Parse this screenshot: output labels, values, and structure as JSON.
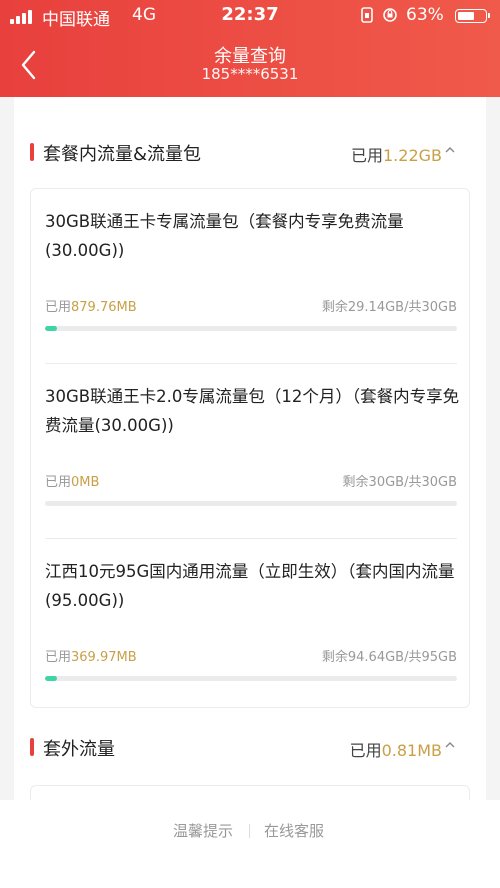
{
  "status_bar": {
    "carrier": "中国联通",
    "network": "4G",
    "time": "22:37",
    "battery_percent": "63%",
    "battery_level": 0.63
  },
  "nav": {
    "title": "余量查询",
    "phone": "185****6531"
  },
  "sections": [
    {
      "name": "套餐内流量&流量包",
      "used_prefix": "已用",
      "used_value": "1.22GB",
      "items": [
        {
          "name": "30GB联通王卡专属流量包（套餐内专享免费流量(30.00G))",
          "used_prefix": "已用",
          "used_value": "879.76MB",
          "remaining": "剩余29.14GB/共30GB",
          "progress": 0.029
        },
        {
          "name": "30GB联通王卡2.0专属流量包（12个月）（套餐内专享免费流量(30.00G))",
          "used_prefix": "已用",
          "used_value": "0MB",
          "remaining": "剩余30GB/共30GB",
          "progress": 0
        },
        {
          "name": "江西10元95G国内通用流量（立即生效）（套内国内流量(95.00G))",
          "used_prefix": "已用",
          "used_value": "369.97MB",
          "remaining": "剩余94.64GB/共95GB",
          "progress": 0.004
        }
      ]
    },
    {
      "name": "套外流量",
      "used_prefix": "已用",
      "used_value": "0.81MB"
    }
  ],
  "footer": {
    "tips_label": "温馨提示",
    "service_label": "在线客服"
  },
  "colors": {
    "header": "#e8403d",
    "accent_gold": "#c9a047",
    "progress": "#3fd4a6"
  }
}
